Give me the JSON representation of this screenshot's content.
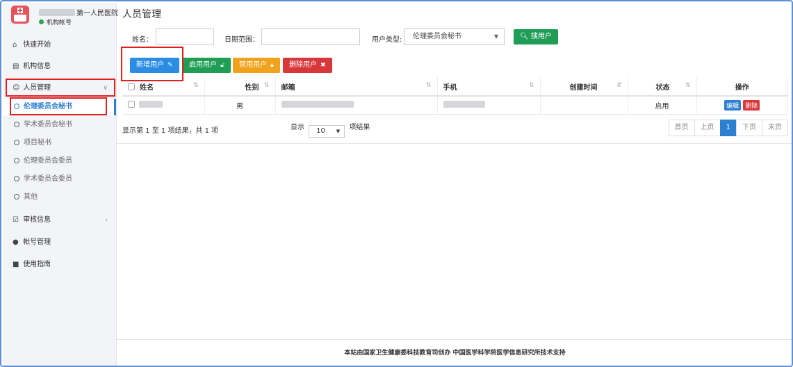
{
  "sidebar": {
    "hospital_name": "第一人民医院",
    "account_label": "机构帐号",
    "items": [
      {
        "label": "快速开始",
        "icon": "home-icon"
      },
      {
        "label": "机构信息",
        "icon": "building-icon"
      },
      {
        "label": "人员管理",
        "icon": "users-icon",
        "expanded": true
      },
      {
        "label": "审核信息",
        "icon": "check-square-icon"
      },
      {
        "label": "帐号管理",
        "icon": "user-icon"
      },
      {
        "label": "使用指南",
        "icon": "book-icon"
      }
    ],
    "subitems": [
      {
        "label": "伦理委员会秘书",
        "active": true
      },
      {
        "label": "学术委员会秘书"
      },
      {
        "label": "项目秘书"
      },
      {
        "label": "伦理委员会委员"
      },
      {
        "label": "学术委员会委员"
      },
      {
        "label": "其他"
      }
    ]
  },
  "main": {
    "title": "人员管理",
    "filters": {
      "name_label": "姓名：",
      "date_label": "日期范围：",
      "user_type_label": "用户类型:",
      "user_type_value": "伦理委员会秘书",
      "search_label": "搜用户"
    },
    "actions": {
      "add": "新增用户",
      "enable": "启用用户",
      "disable": "禁用用户",
      "delete": "删除用户"
    },
    "table": {
      "headers": [
        "姓名",
        "性别",
        "邮箱",
        "手机",
        "创建时间",
        "状态",
        "操作"
      ],
      "rows": [
        {
          "name": "",
          "gender": "男",
          "email": "",
          "phone": "",
          "created": "",
          "status": "启用",
          "edit": "编辑",
          "delete": "删除"
        }
      ]
    },
    "pagination": {
      "info": "显示第 1 至 1 项结果，共 1 项",
      "show_prefix": "显示",
      "page_size": "10",
      "show_suffix": "项结果",
      "first": "首页",
      "prev": "上页",
      "current": "1",
      "next": "下页",
      "last": "末页"
    },
    "footer": "本站由国家卫生健康委科技教育司创办 中国医学科学院医学信息研究所技术支持"
  },
  "colors": {
    "primary": "#2d7fd0",
    "green": "#1f9d55",
    "orange": "#f0a21c",
    "red": "#d9383a",
    "highlight": "#e02020"
  }
}
